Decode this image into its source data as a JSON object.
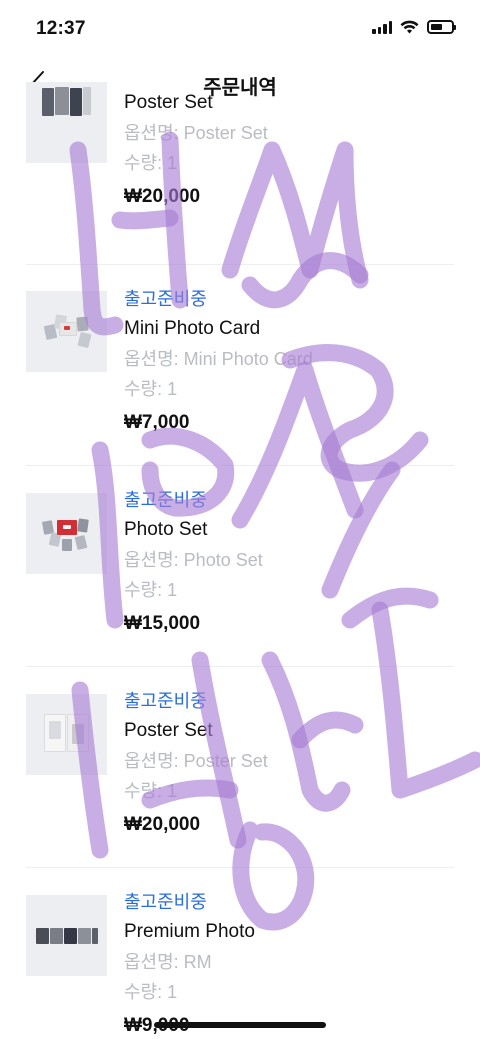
{
  "status_bar": {
    "time": "12:37",
    "icons": [
      "signal-icon",
      "wifi-icon",
      "battery-icon"
    ]
  },
  "nav": {
    "back_icon": "chevron-left-icon",
    "title": "주문내역"
  },
  "colors": {
    "status_blue": "#2a6dde",
    "muted_text": "#b9bcc2",
    "thumb_bg": "#eceef2",
    "scribble_purple": "#a77dd4"
  },
  "orders": [
    {
      "status": "",
      "name": "Poster Set",
      "option": "옵션명: Poster Set",
      "quantity": "수량: 1",
      "price": "₩20,000"
    },
    {
      "status": "출고준비중",
      "name": "Mini Photo Card",
      "option": "옵션명: Mini Photo Card",
      "quantity": "수량: 1",
      "price": "₩7,000"
    },
    {
      "status": "출고준비중",
      "name": "Photo Set",
      "option": "옵션명: Photo Set",
      "quantity": "수량: 1",
      "price": "₩15,000"
    },
    {
      "status": "출고준비중",
      "name": "Poster Set",
      "option": "옵션명: Poster Set",
      "quantity": "수량: 1",
      "price": "₩20,000"
    },
    {
      "status": "출고준비중",
      "name": "Premium Photo",
      "option": "옵션명: RM",
      "quantity": "수량: 1",
      "price": "₩9,000"
    }
  ]
}
